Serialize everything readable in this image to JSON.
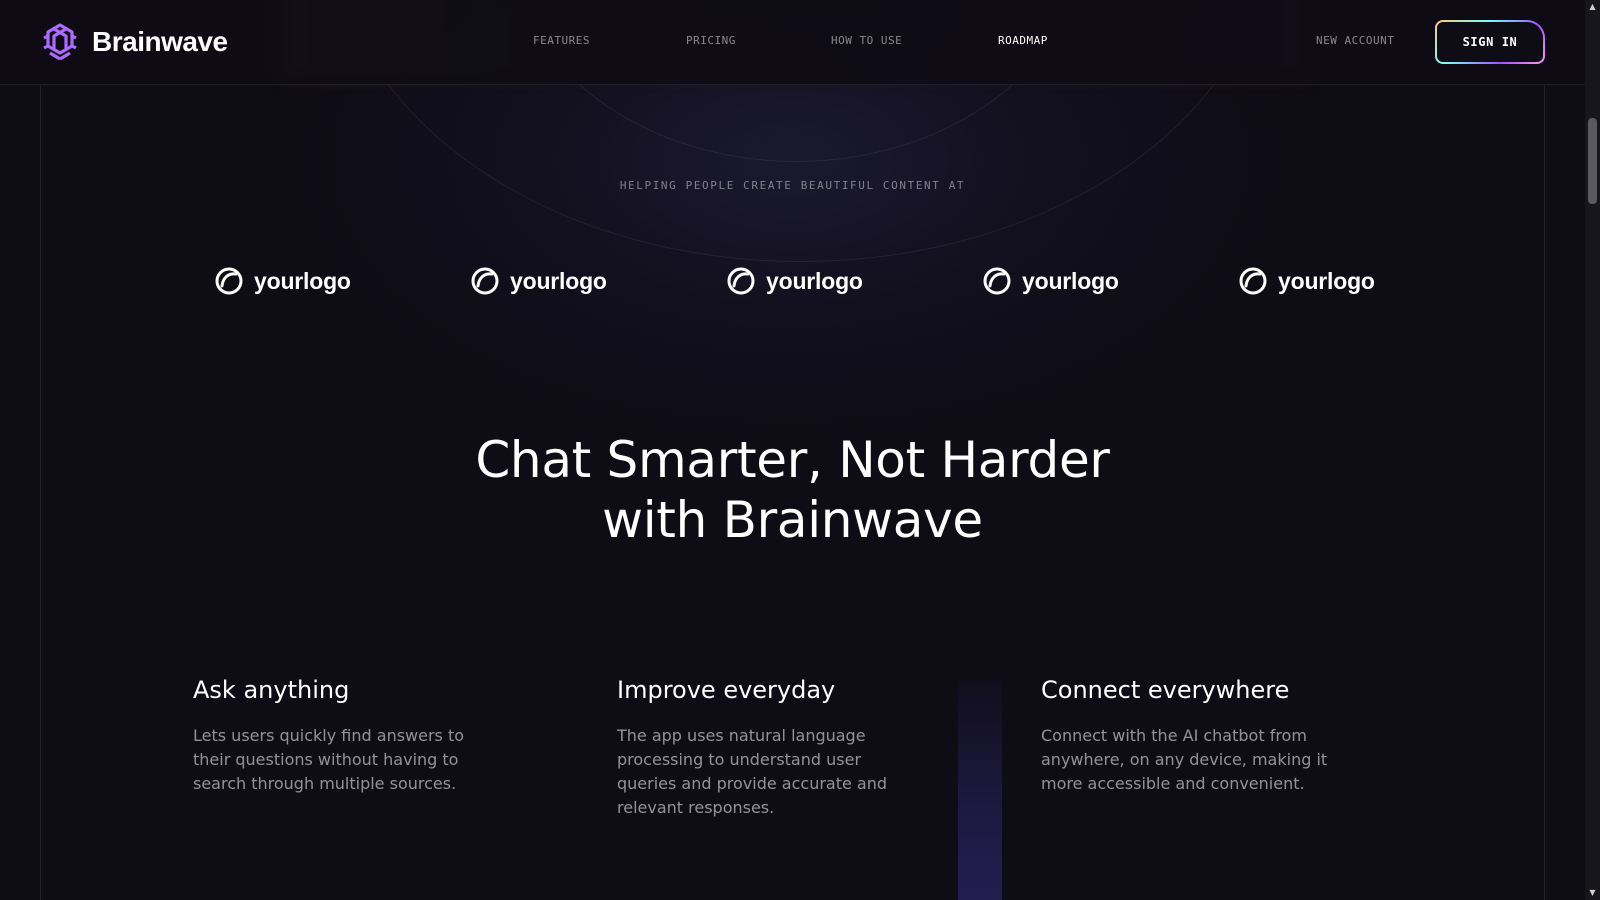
{
  "brand": {
    "name": "Brainwave",
    "icon": "brainwave-logo-icon",
    "accent": "#ac6aff"
  },
  "nav": {
    "items": [
      {
        "label": "FEATURES",
        "active": false
      },
      {
        "label": "PRICING",
        "active": false
      },
      {
        "label": "HOW TO USE",
        "active": false
      },
      {
        "label": "ROADMAP",
        "active": true
      }
    ],
    "new_account": "NEW ACCOUNT",
    "sign_in": "SIGN IN"
  },
  "hero": {
    "tagline": "HELPING PEOPLE CREATE BEAUTIFUL CONTENT AT",
    "logos": [
      {
        "text": "yourlogo",
        "icon": "yourlogo-icon"
      },
      {
        "text": "yourlogo",
        "icon": "yourlogo-icon"
      },
      {
        "text": "yourlogo",
        "icon": "yourlogo-icon"
      },
      {
        "text": "yourlogo",
        "icon": "yourlogo-icon"
      },
      {
        "text": "yourlogo",
        "icon": "yourlogo-icon"
      }
    ]
  },
  "benefits": {
    "heading_line1": "Chat Smarter, Not Harder",
    "heading_line2": "with Brainwave",
    "items": [
      {
        "title": "Ask anything",
        "text": "Lets users quickly find answers to their questions without having to search through multiple sources."
      },
      {
        "title": "Improve everyday",
        "text": "The app uses natural language processing to understand user queries and provide accurate and relevant responses."
      },
      {
        "title": "Connect everywhere",
        "text": "Connect with the AI chatbot from anywhere, on any device, making it more accessible and convenient."
      }
    ]
  }
}
